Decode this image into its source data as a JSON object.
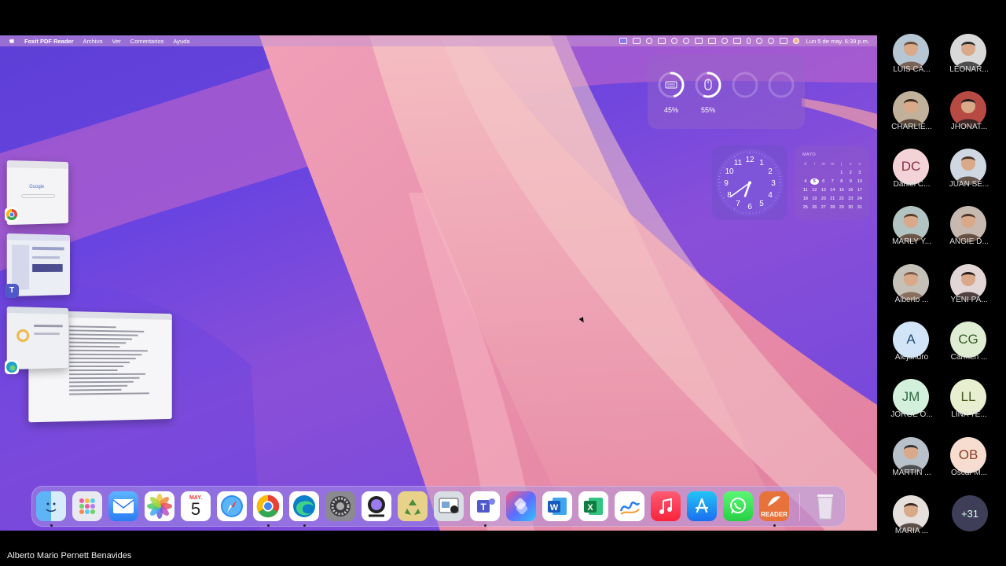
{
  "menubar": {
    "app_name": "Foxit PDF Reader",
    "menus": [
      "Archivo",
      "Ver",
      "Comentarios",
      "Ayuda"
    ],
    "datetime": "Lun 5 de may.  6:39 p.m."
  },
  "battery_widget": {
    "items": [
      {
        "icon": "keyboard-icon",
        "percent": "45%",
        "level": 0.45
      },
      {
        "icon": "mouse-icon",
        "percent": "55%",
        "level": 0.55
      }
    ]
  },
  "calendar": {
    "month": "MAYO",
    "weekdays": [
      "d",
      "l",
      "m",
      "m",
      "j",
      "v",
      "s"
    ],
    "days": [
      "",
      "",
      "",
      "",
      "1",
      "2",
      "3",
      "4",
      "5",
      "6",
      "7",
      "8",
      "9",
      "10",
      "11",
      "12",
      "13",
      "14",
      "15",
      "16",
      "17",
      "18",
      "19",
      "20",
      "21",
      "22",
      "23",
      "24",
      "25",
      "26",
      "27",
      "28",
      "29",
      "30",
      "31"
    ],
    "today": "5"
  },
  "clock": {
    "hour": 6,
    "minute": 39,
    "numbers": [
      "12",
      "1",
      "2",
      "3",
      "4",
      "5",
      "6",
      "7",
      "8",
      "9",
      "10",
      "11"
    ]
  },
  "stage_manager": {
    "windows": [
      "chrome-window",
      "teams-window",
      "edge-window"
    ],
    "google_label": "Google"
  },
  "dock": {
    "calendar_month": "MAY.",
    "calendar_day": "5",
    "word_letter": "W",
    "excel_letter": "X",
    "reader_label": "READER",
    "apps": [
      "finder-icon",
      "launchpad-icon",
      "mail-icon",
      "photos-icon",
      "calendar-icon",
      "safari-icon",
      "chrome-icon",
      "edge-icon",
      "system-settings-icon",
      "webcam-icon",
      "recycle-icon",
      "preview-icon",
      "teams-icon",
      "shortcuts-icon",
      "word-icon",
      "excel-icon",
      "freeform-icon",
      "music-icon",
      "app-store-icon",
      "whatsapp-icon",
      "foxit-reader-icon",
      "trash-icon"
    ]
  },
  "participants": [
    {
      "name": "LUIS CA...",
      "initials": "",
      "photo": true
    },
    {
      "name": "LEONAR...",
      "initials": "",
      "photo": true
    },
    {
      "name": "CHARLIE...",
      "initials": "",
      "photo": true
    },
    {
      "name": "JHONAT...",
      "initials": "",
      "photo": true
    },
    {
      "name": "Daniel C...",
      "initials": "DC",
      "photo": false,
      "bg": "#f3d3d7",
      "fg": "#8a3040"
    },
    {
      "name": "JUAN SE...",
      "initials": "",
      "photo": true
    },
    {
      "name": "MARLY Y...",
      "initials": "",
      "photo": true
    },
    {
      "name": "ANGIE D...",
      "initials": "",
      "photo": true
    },
    {
      "name": "Alberto ...",
      "initials": "",
      "photo": true
    },
    {
      "name": "YENI PA...",
      "initials": "",
      "photo": true
    },
    {
      "name": "Alejandro",
      "initials": "A",
      "photo": false,
      "bg": "#d2e4f7",
      "fg": "#1f4a7a"
    },
    {
      "name": "Carmen ...",
      "initials": "CG",
      "photo": false,
      "bg": "#dfeed3",
      "fg": "#3a5a2a"
    },
    {
      "name": "JORGE O...",
      "initials": "JM",
      "photo": false,
      "bg": "#d2f0dc",
      "fg": "#2f6a43"
    },
    {
      "name": "LINA TE...",
      "initials": "LL",
      "photo": false,
      "bg": "#e7efd0",
      "fg": "#4a5a22"
    },
    {
      "name": "MARTIN ...",
      "initials": "",
      "photo": true
    },
    {
      "name": "Oscar M...",
      "initials": "OB",
      "photo": false,
      "bg": "#f7dcd0",
      "fg": "#8a3e22"
    },
    {
      "name": "MARIA ...",
      "initials": "",
      "photo": true
    }
  ],
  "more_participants": "+31",
  "presenter_name": "Alberto Mario Pernett Benavides"
}
